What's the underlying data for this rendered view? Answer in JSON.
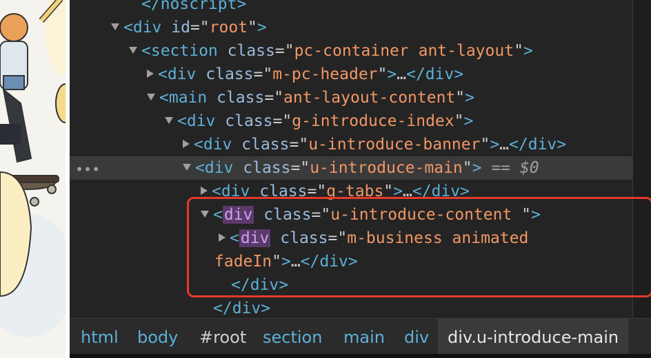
{
  "dom_tree": {
    "lines": [
      {
        "indent": 3,
        "toggle": "none",
        "parts": [
          [
            "tag",
            "</noscript>"
          ]
        ]
      },
      {
        "indent": 2,
        "toggle": "down",
        "parts": [
          [
            "tag",
            "<div "
          ],
          [
            "attr",
            "id"
          ],
          [
            "txt",
            "=\""
          ],
          [
            "val",
            "root"
          ],
          [
            "txt",
            "\""
          ],
          [
            "tag",
            ">"
          ]
        ]
      },
      {
        "indent": 3,
        "toggle": "down",
        "parts": [
          [
            "tag",
            "<section "
          ],
          [
            "attr",
            "class"
          ],
          [
            "txt",
            "=\""
          ],
          [
            "val",
            "pc-container ant-layout"
          ],
          [
            "txt",
            "\""
          ],
          [
            "tag",
            ">"
          ]
        ]
      },
      {
        "indent": 4,
        "toggle": "right",
        "parts": [
          [
            "tag",
            "<div "
          ],
          [
            "attr",
            "class"
          ],
          [
            "txt",
            "=\""
          ],
          [
            "val",
            "m-pc-header"
          ],
          [
            "txt",
            "\""
          ],
          [
            "tag",
            ">"
          ],
          [
            "txt",
            "…"
          ],
          [
            "tag",
            "</div>"
          ]
        ]
      },
      {
        "indent": 4,
        "toggle": "down",
        "parts": [
          [
            "tag",
            "<main "
          ],
          [
            "attr",
            "class"
          ],
          [
            "txt",
            "=\""
          ],
          [
            "val",
            "ant-layout-content"
          ],
          [
            "txt",
            "\""
          ],
          [
            "tag",
            ">"
          ]
        ]
      },
      {
        "indent": 5,
        "toggle": "down",
        "parts": [
          [
            "tag",
            "<div "
          ],
          [
            "attr",
            "class"
          ],
          [
            "txt",
            "=\""
          ],
          [
            "val",
            "g-introduce-index"
          ],
          [
            "txt",
            "\""
          ],
          [
            "tag",
            ">"
          ]
        ]
      },
      {
        "indent": 6,
        "toggle": "right",
        "parts": [
          [
            "tag",
            "<div "
          ],
          [
            "attr",
            "class"
          ],
          [
            "txt",
            "=\""
          ],
          [
            "val",
            "u-introduce-banner"
          ],
          [
            "txt",
            "\""
          ],
          [
            "tag",
            ">"
          ],
          [
            "txt",
            "…"
          ],
          [
            "tag",
            "</div>"
          ]
        ]
      },
      {
        "indent": 6,
        "toggle": "down",
        "selected": true,
        "parts": [
          [
            "tag",
            "<div "
          ],
          [
            "attr",
            "class"
          ],
          [
            "txt",
            "=\""
          ],
          [
            "val",
            "u-introduce-main"
          ],
          [
            "txt",
            "\""
          ],
          [
            "tag",
            ">"
          ],
          [
            "eq",
            " == "
          ],
          [
            "eqi",
            "$0"
          ]
        ]
      },
      {
        "indent": 7,
        "toggle": "right",
        "parts": [
          [
            "tag",
            "<div "
          ],
          [
            "attr",
            "class"
          ],
          [
            "txt",
            "=\""
          ],
          [
            "val",
            "g-tabs"
          ],
          [
            "txt",
            "\""
          ],
          [
            "tag",
            ">"
          ],
          [
            "txt",
            "…"
          ],
          [
            "tag",
            "</div>"
          ]
        ]
      },
      {
        "indent": 7,
        "toggle": "down",
        "parts": [
          [
            "tag",
            "<"
          ],
          [
            "hl",
            "div"
          ],
          [
            "tag",
            " "
          ],
          [
            "attr",
            "class"
          ],
          [
            "txt",
            "=\""
          ],
          [
            "val",
            "u-introduce-content "
          ],
          [
            "txt",
            "\""
          ],
          [
            "tag",
            ">"
          ]
        ]
      },
      {
        "indent": 8,
        "toggle": "right",
        "parts": [
          [
            "tag",
            "<"
          ],
          [
            "hl",
            "div"
          ],
          [
            "tag",
            " "
          ],
          [
            "attr",
            "class"
          ],
          [
            "txt",
            "=\""
          ],
          [
            "val",
            "m-business animated"
          ]
        ]
      },
      {
        "indent": 7,
        "toggle": "cont",
        "parts": [
          [
            "val",
            "fadeIn"
          ],
          [
            "txt",
            "\""
          ],
          [
            "tag",
            ">"
          ],
          [
            "txt",
            "…"
          ],
          [
            "tag",
            "</div>"
          ]
        ]
      },
      {
        "indent": 8,
        "toggle": "none",
        "parts": [
          [
            "tag",
            "</div>"
          ]
        ]
      },
      {
        "indent": 7,
        "toggle": "none",
        "parts": [
          [
            "tag",
            "</div>"
          ]
        ]
      }
    ],
    "selected_dots": "•••"
  },
  "breadcrumbs": [
    "html",
    "body",
    "#root",
    "section",
    "main",
    "div",
    "div.u-introduce-main"
  ],
  "colors": {
    "tag": "#5db0d7",
    "attribute": "#9bbbdc",
    "value": "#f29766",
    "highlight_box": "#e53a2a"
  }
}
